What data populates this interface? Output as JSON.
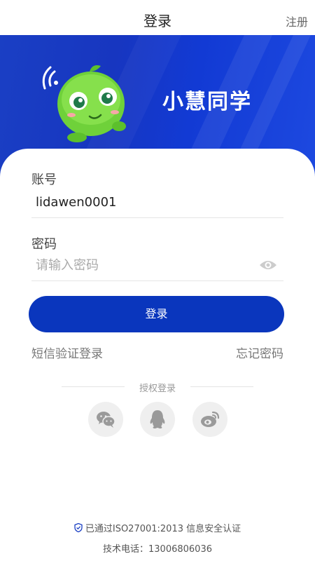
{
  "header": {
    "title": "登录",
    "register_label": "注册"
  },
  "banner": {
    "brand_text": "小慧同学"
  },
  "form": {
    "account_label": "账号",
    "account_value": "lidawen0001",
    "password_label": "密码",
    "password_placeholder": "请输入密码",
    "login_button": "登录"
  },
  "links": {
    "sms_login": "短信验证登录",
    "forgot_password": "忘记密码"
  },
  "auth": {
    "divider_label": "授权登录",
    "providers": [
      "wechat-icon",
      "qq-icon",
      "weibo-icon"
    ]
  },
  "footer": {
    "certification": "已通过ISO27001:2013 信息安全认证",
    "tech_phone": "技术电话：13006806036"
  },
  "colors": {
    "primary": "#0a36bd",
    "banner": "#1736c0",
    "mascot": "#6fd13a"
  }
}
